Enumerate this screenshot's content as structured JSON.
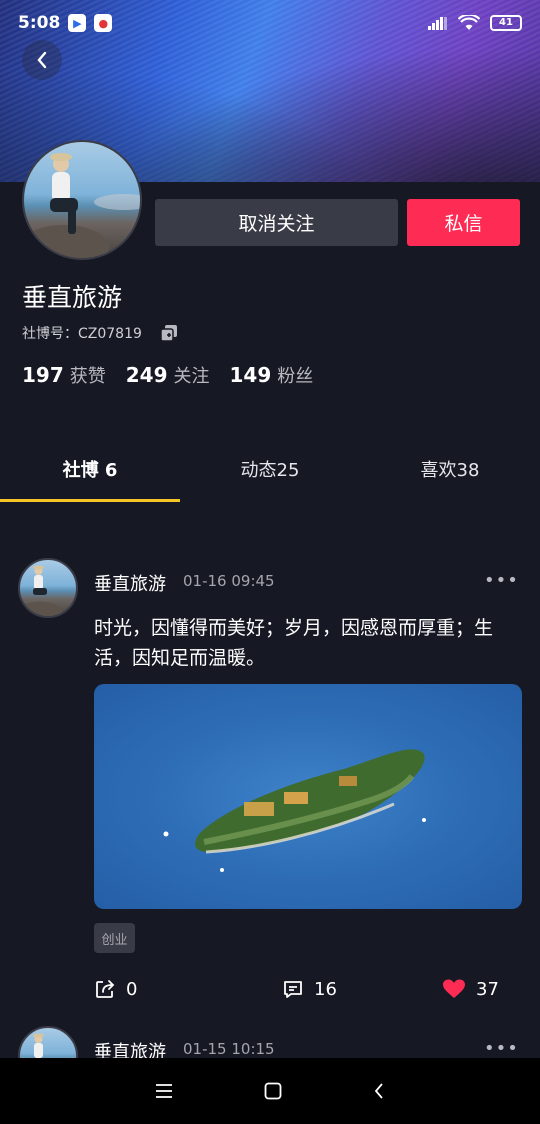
{
  "status_bar": {
    "time": "5:08",
    "battery": "41"
  },
  "profile": {
    "name": "垂直旅游",
    "id_text": "社博号：CZ07819",
    "unfollow_label": "取消关注",
    "message_label": "私信",
    "stats": [
      {
        "value": "197",
        "label": "获赞"
      },
      {
        "value": "249",
        "label": "关注"
      },
      {
        "value": "149",
        "label": "粉丝"
      }
    ]
  },
  "tabs": [
    {
      "label": "社博 6",
      "active": true
    },
    {
      "label": "动态25",
      "active": false
    },
    {
      "label": "喜欢38",
      "active": false
    }
  ],
  "posts": [
    {
      "author": "垂直旅游",
      "time": "01-16 09:45",
      "text": "时光，因懂得而美好；岁月，因感恩而厚重；生活，因知足而温暖。",
      "tag": "创业",
      "shares": "0",
      "comments": "16",
      "likes": "37"
    },
    {
      "author": "垂直旅游",
      "time": "01-15 10:15"
    }
  ],
  "colors": {
    "accent_red": "#fe2c55",
    "tab_indicator": "#f5c425",
    "background": "#161823"
  },
  "icons": {
    "back": "chevron-left-icon",
    "copy": "copy-icon",
    "share": "share-icon",
    "comment": "comment-icon",
    "like": "heart-icon",
    "more": "more-dots-icon"
  }
}
